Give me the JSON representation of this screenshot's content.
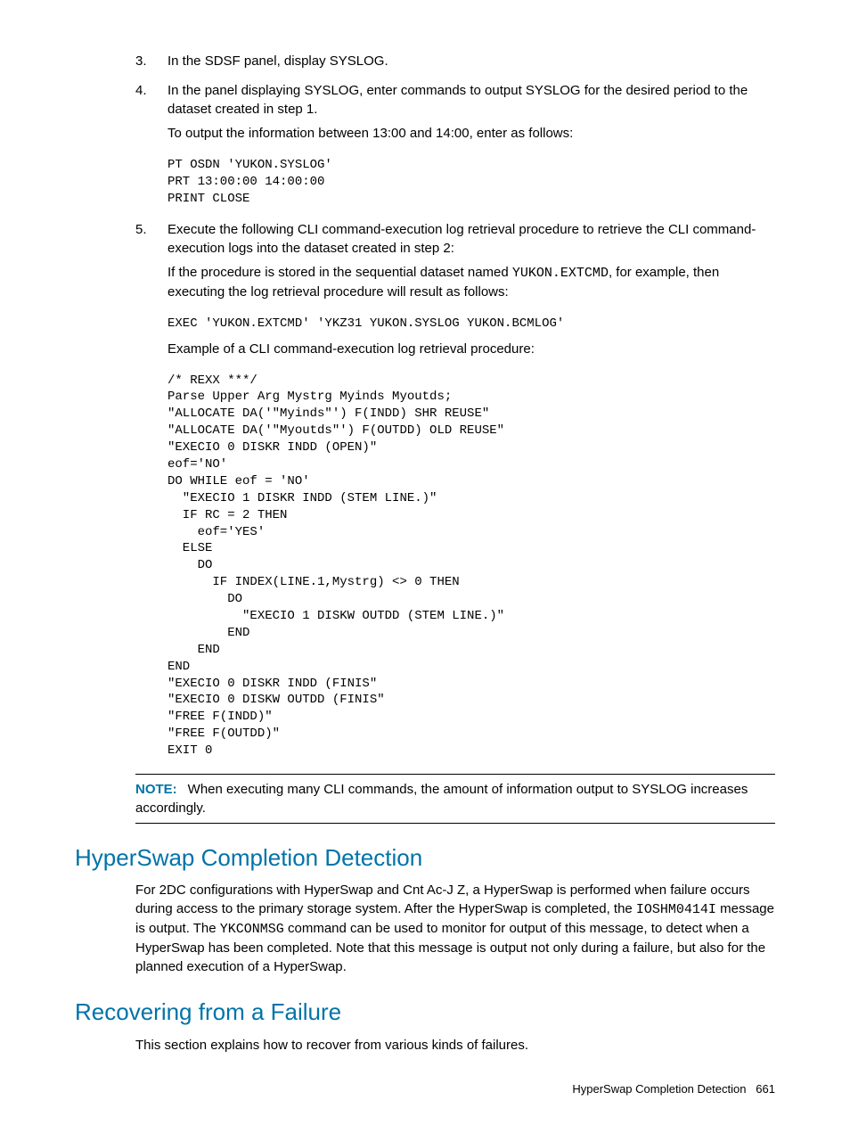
{
  "steps": {
    "s3": {
      "num": "3.",
      "p1": "In the SDSF panel, display SYSLOG."
    },
    "s4": {
      "num": "4.",
      "p1": "In the panel displaying SYSLOG, enter commands to output SYSLOG for the desired period to the dataset created in step 1.",
      "p2": "To output the information between 13:00 and 14:00, enter as follows:",
      "code": "PT OSDN 'YUKON.SYSLOG'\nPRT 13:00:00 14:00:00\nPRINT CLOSE"
    },
    "s5": {
      "num": "5.",
      "p1": "Execute the following CLI command-execution log retrieval procedure to retrieve the CLI command-execution logs into the dataset created in step 2:",
      "p2a": "If the procedure is stored in the sequential dataset named ",
      "p2code": "YUKON.EXTCMD",
      "p2b": ", for example, then executing the log retrieval procedure will result as follows:",
      "code1": "EXEC 'YUKON.EXTCMD' 'YKZ31 YUKON.SYSLOG YUKON.BCMLOG'",
      "p3": "Example of a CLI command-execution log retrieval procedure:",
      "code2": "/* REXX ***/\nParse Upper Arg Mystrg Myinds Myoutds;\n\"ALLOCATE DA('\"Myinds\"') F(INDD) SHR REUSE\"\n\"ALLOCATE DA('\"Myoutds\"') F(OUTDD) OLD REUSE\"\n\"EXECIO 0 DISKR INDD (OPEN)\"\neof='NO'\nDO WHILE eof = 'NO'\n  \"EXECIO 1 DISKR INDD (STEM LINE.)\"\n  IF RC = 2 THEN\n    eof='YES'\n  ELSE\n    DO\n      IF INDEX(LINE.1,Mystrg) <> 0 THEN\n        DO\n          \"EXECIO 1 DISKW OUTDD (STEM LINE.)\"\n        END\n    END\nEND\n\"EXECIO 0 DISKR INDD (FINIS\"\n\"EXECIO 0 DISKW OUTDD (FINIS\"\n\"FREE F(INDD)\"\n\"FREE F(OUTDD)\"\nEXIT 0"
    }
  },
  "note": {
    "label": "NOTE:",
    "text": "When executing many CLI commands, the amount of information output to SYSLOG increases accordingly."
  },
  "section1": {
    "heading": "HyperSwap Completion Detection",
    "p_a": "For 2DC configurations with HyperSwap and Cnt Ac-J Z, a HyperSwap is performed when failure occurs during access to the primary storage system. After the HyperSwap is completed, the ",
    "code1": "IOSHM0414I",
    "p_b": " message is output. The ",
    "code2": "YKCONMSG",
    "p_c": " command can be used to monitor for output of this message, to detect when a HyperSwap has been completed. Note that this message is output not only during a failure, but also for the planned execution of a HyperSwap."
  },
  "section2": {
    "heading": "Recovering from a Failure",
    "p": "This section explains how to recover from various kinds of failures."
  },
  "footer": {
    "text": "HyperSwap Completion Detection",
    "page": "661"
  }
}
